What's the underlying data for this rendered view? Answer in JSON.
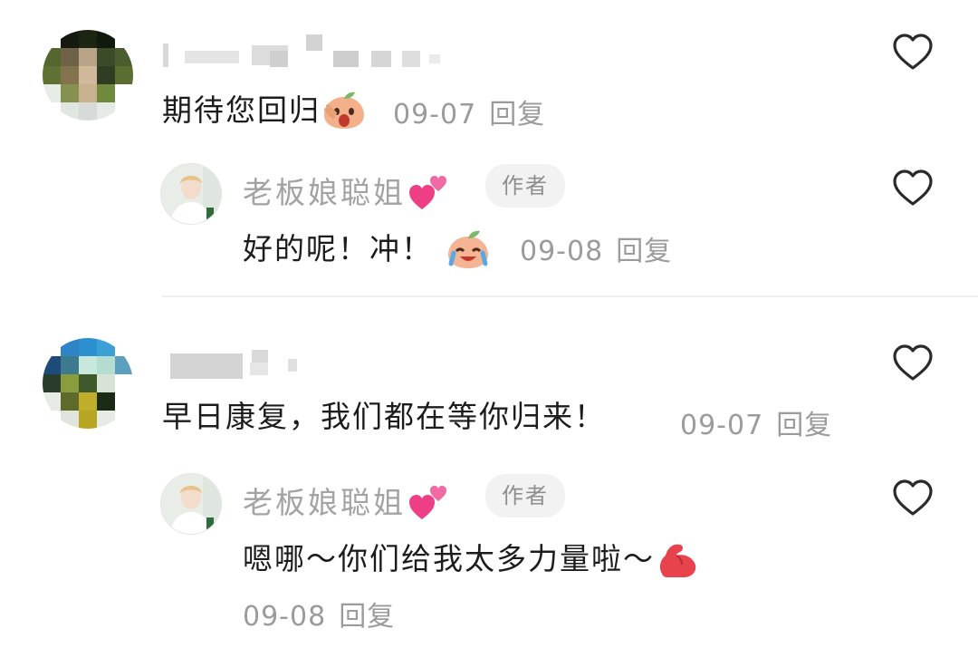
{
  "comments": [
    {
      "comment_text": "期待您回归",
      "date": "09-07",
      "reply_label": "回复",
      "emoji": "peach-shocked-emoji",
      "reply": {
        "author_name": "老板娘聪姐",
        "author_tag": "作者",
        "name_emoji": "pink-hearts-emoji",
        "comment_text": "好的呢！冲！",
        "emoji": "peach-crying-emoji",
        "date": "09-08",
        "reply_label": "回复"
      }
    },
    {
      "comment_text": "早日康复，我们都在等你归来！",
      "date": "09-07",
      "reply_label": "回复",
      "reply": {
        "author_name": "老板娘聪姐",
        "author_tag": "作者",
        "name_emoji": "pink-hearts-emoji",
        "comment_text": "嗯哪～你们给我太多力量啦～",
        "emoji": "flexed-biceps-emoji",
        "date": "09-08",
        "reply_label": "回复"
      }
    }
  ],
  "colors": {
    "meta_text": "#9b9b9b",
    "author_name": "#a3a3a3",
    "tag_bg": "#f2f2f2",
    "divider": "#ededed"
  }
}
